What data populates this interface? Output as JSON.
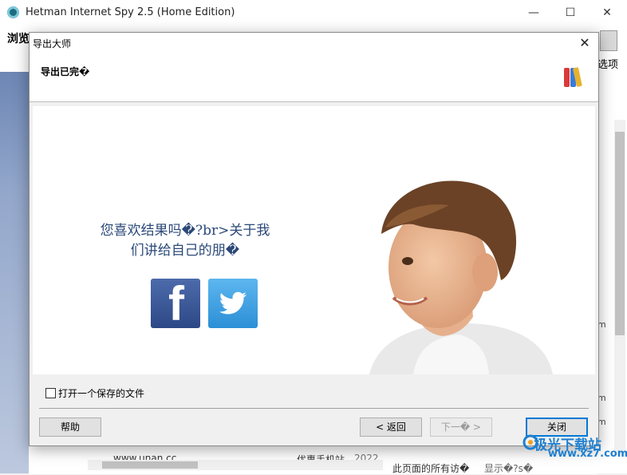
{
  "app": {
    "title": "Hetman Internet Spy 2.5 (Home Edition)",
    "toolbar_title": "浏览历史",
    "options_label": "选项",
    "bottom_col1": "www.unan.cc",
    "bottom_col2": "优惠手机站",
    "bottom_col2_extra": "2022",
    "bottom_col3": "此页面的所有访�",
    "bottom_col4": "显示�?s�",
    "right_partial": [
      "m",
      "m",
      "m"
    ]
  },
  "window_controls": {
    "minimize": "—",
    "maximize": "☐",
    "close": "✕"
  },
  "dialog": {
    "title": "导出大师",
    "close": "✕",
    "header_title": "导出已完�",
    "message_line1": "您喜欢结果吗�?br>关于我",
    "message_line2": "们讲给自己的朋�",
    "checkbox_label": "打开一个保存的文件",
    "checkbox_checked": false,
    "buttons": {
      "help": "帮助",
      "back": "< 返回",
      "next": "下一� >",
      "close": "关闭"
    }
  },
  "watermark": {
    "text": "极光下载站",
    "url": "www.xz7.com"
  },
  "colors": {
    "accent": "#0078d7",
    "message": "#2b4878",
    "facebook": "#3b5998",
    "twitter": "#3aa0e4"
  }
}
